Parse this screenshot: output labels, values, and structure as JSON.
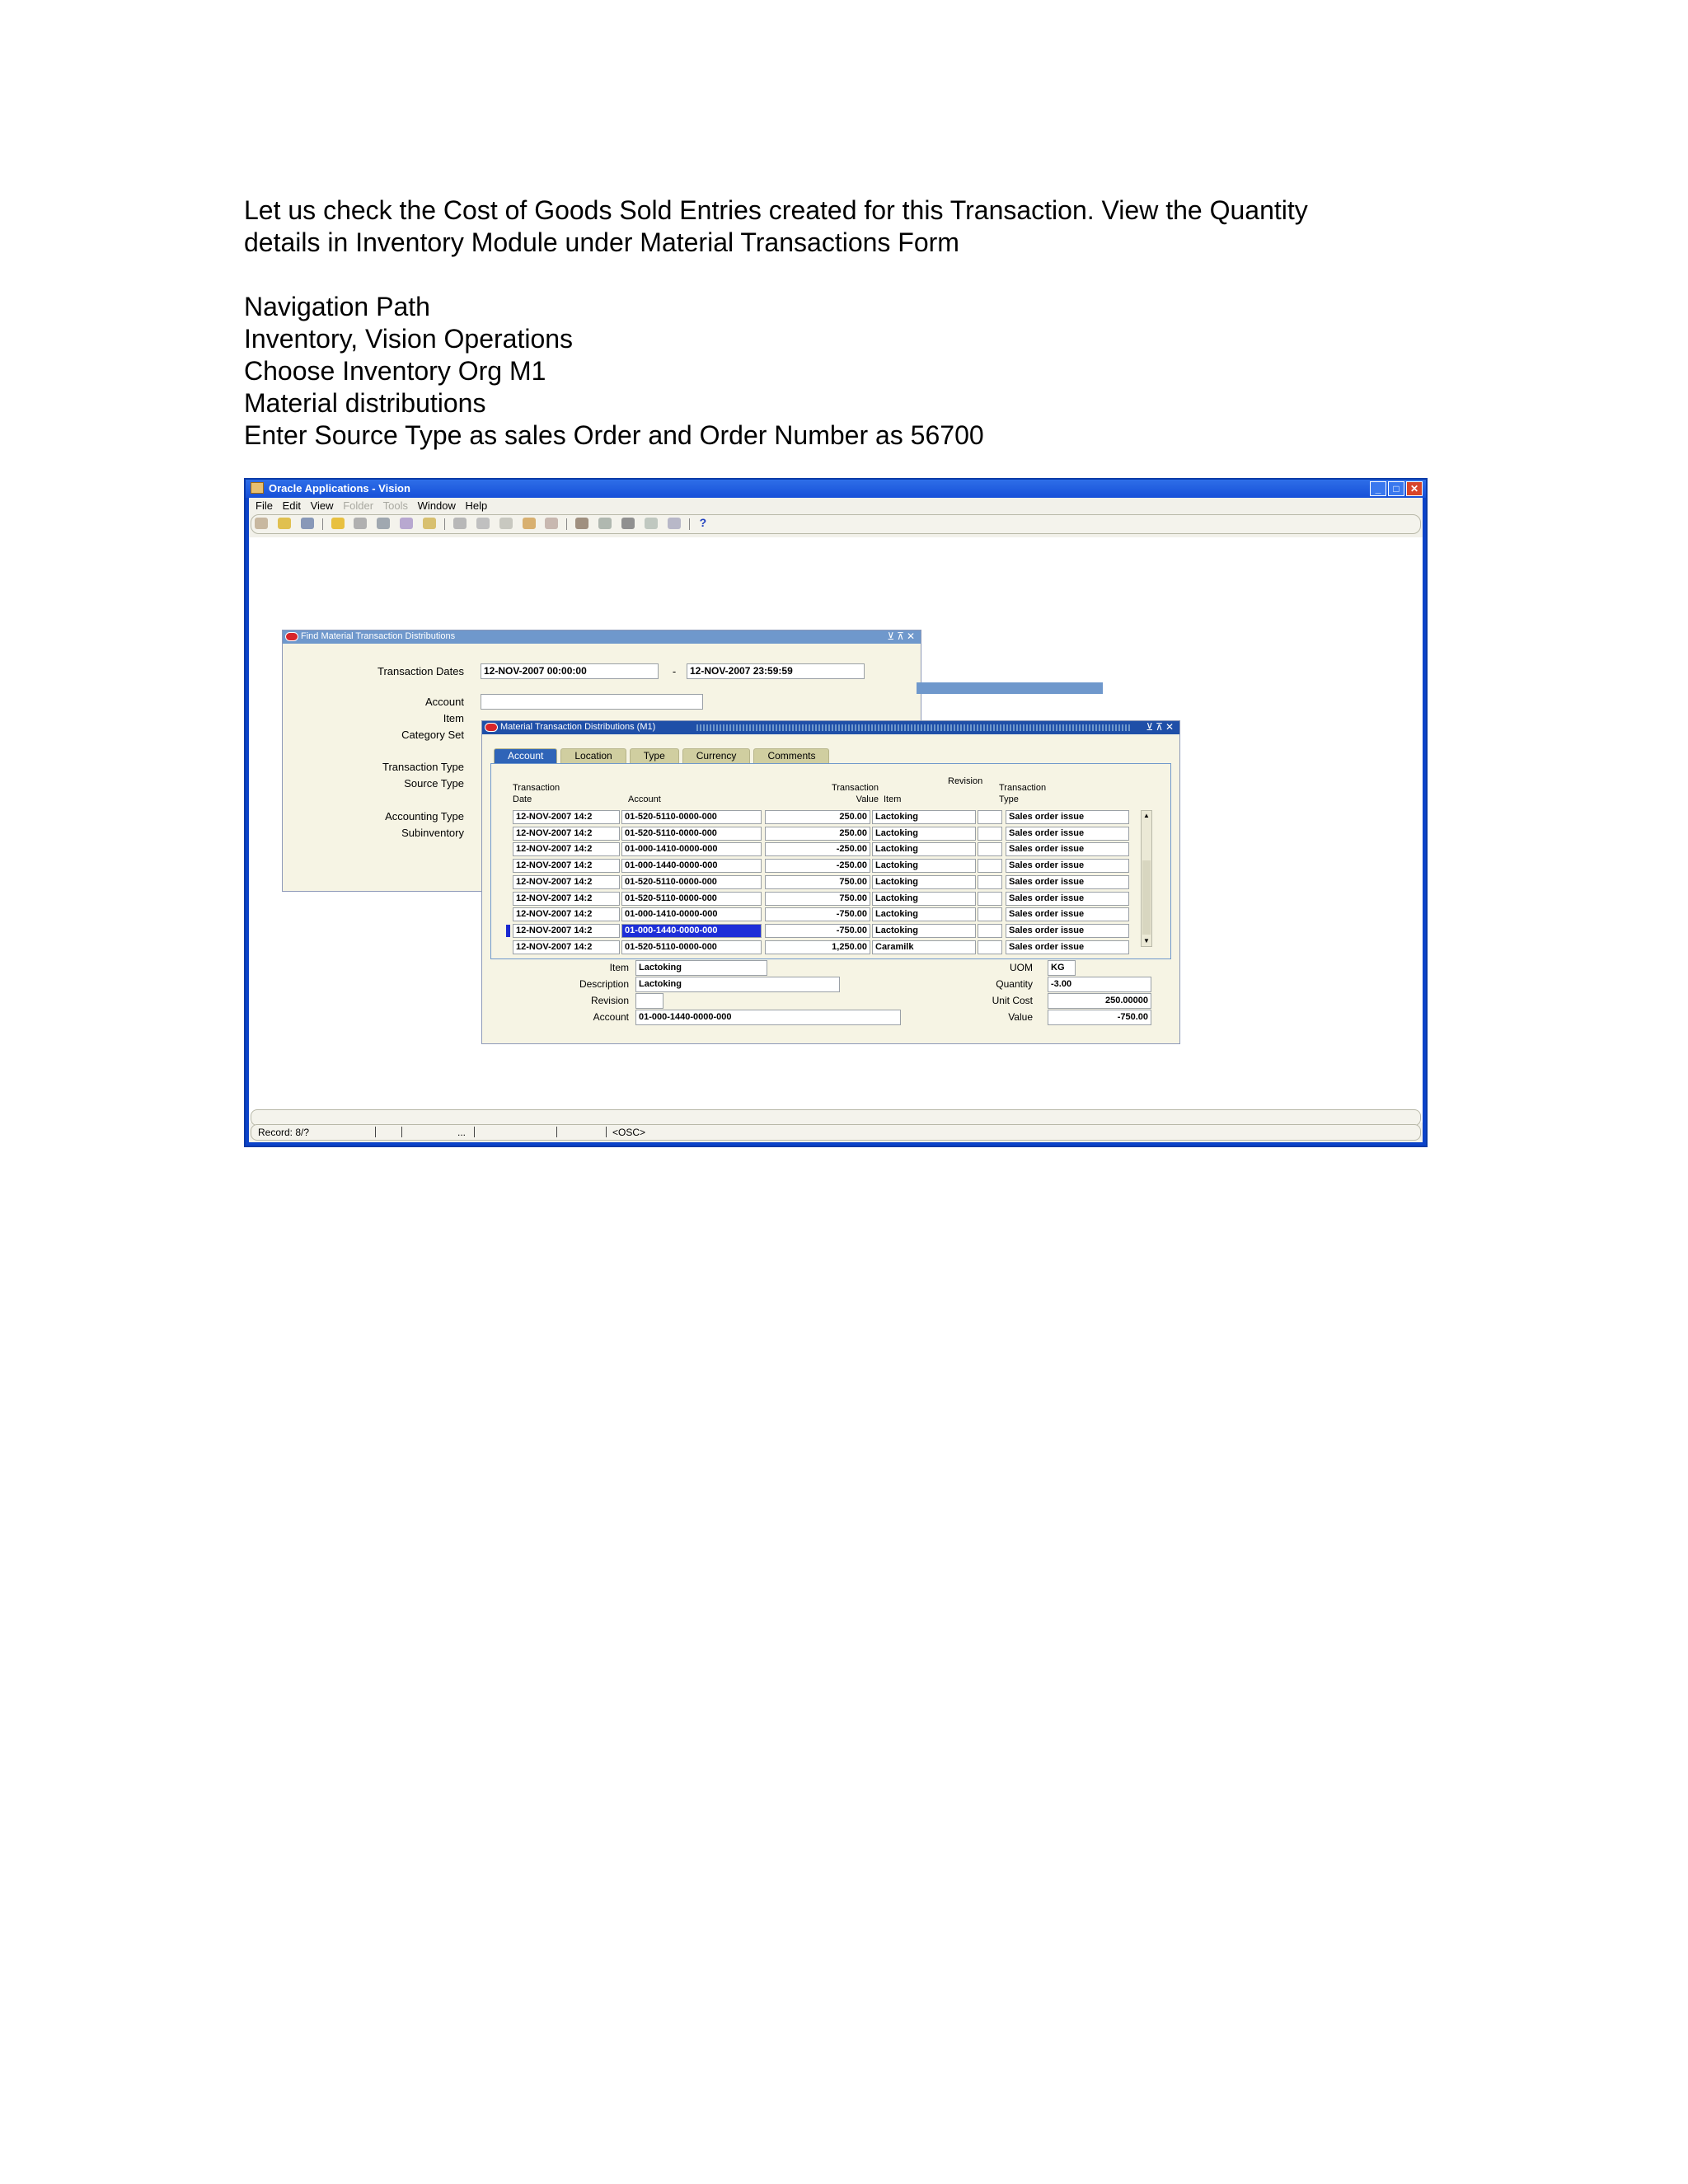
{
  "intro": {
    "lines": [
      "Let us check the Cost of Goods Sold Entries created for this Transaction. View the Quantity",
      "details in Inventory Module under Material Transactions Form",
      "",
      "Navigation Path",
      "Inventory, Vision Operations",
      "Choose Inventory Org M1",
      "Material distributions",
      "Enter Source Type as sales Order and Order Number as 56700"
    ]
  },
  "app": {
    "title": "Oracle Applications - Vision",
    "menu": [
      "File",
      "Edit",
      "View",
      "Folder",
      "Tools",
      "Window",
      "Help"
    ],
    "status": {
      "record": "Record: 8/?",
      "ellipsis": "...",
      "osc": "<OSC>"
    }
  },
  "find": {
    "title": "Find Material Transaction Distributions",
    "labels": {
      "transaction_dates": "Transaction Dates",
      "account": "Account",
      "item": "Item",
      "category_set": "Category Set",
      "transaction_type": "Transaction Type",
      "source_type": "Source Type",
      "accounting_type": "Accounting Type",
      "subinventory": "Subinventory"
    },
    "date_from": "12-NOV-2007 00:00:00",
    "date_to": "12-NOV-2007 23:59:59",
    "date_sep": "-"
  },
  "mtd": {
    "title": "Material Transaction Distributions (M1)",
    "tabs": [
      "Account",
      "Location",
      "Type",
      "Currency",
      "Comments"
    ],
    "headers": {
      "trans_date_1": "Transaction",
      "trans_date_2": "Date",
      "account": "Account",
      "value_1": "Transaction",
      "value_2": "Value",
      "item": "Item",
      "revision": "Revision",
      "type_1": "Transaction",
      "type_2": "Type"
    },
    "rows": [
      {
        "date": "12-NOV-2007 14:2",
        "account": "01-520-5110-0000-000",
        "value": "250.00",
        "item": "Lactoking",
        "rev": "",
        "type": "Sales order issue"
      },
      {
        "date": "12-NOV-2007 14:2",
        "account": "01-520-5110-0000-000",
        "value": "250.00",
        "item": "Lactoking",
        "rev": "",
        "type": "Sales order issue"
      },
      {
        "date": "12-NOV-2007 14:2",
        "account": "01-000-1410-0000-000",
        "value": "-250.00",
        "item": "Lactoking",
        "rev": "",
        "type": "Sales order issue"
      },
      {
        "date": "12-NOV-2007 14:2",
        "account": "01-000-1440-0000-000",
        "value": "-250.00",
        "item": "Lactoking",
        "rev": "",
        "type": "Sales order issue"
      },
      {
        "date": "12-NOV-2007 14:2",
        "account": "01-520-5110-0000-000",
        "value": "750.00",
        "item": "Lactoking",
        "rev": "",
        "type": "Sales order issue"
      },
      {
        "date": "12-NOV-2007 14:2",
        "account": "01-520-5110-0000-000",
        "value": "750.00",
        "item": "Lactoking",
        "rev": "",
        "type": "Sales order issue"
      },
      {
        "date": "12-NOV-2007 14:2",
        "account": "01-000-1410-0000-000",
        "value": "-750.00",
        "item": "Lactoking",
        "rev": "",
        "type": "Sales order issue"
      },
      {
        "date": "12-NOV-2007 14:2",
        "account": "01-000-1440-0000-000",
        "value": "-750.00",
        "item": "Lactoking",
        "rev": "",
        "type": "Sales order issue"
      },
      {
        "date": "12-NOV-2007 14:2",
        "account": "01-520-5110-0000-000",
        "value": "1,250.00",
        "item": "Caramilk",
        "rev": "",
        "type": "Sales order issue"
      }
    ],
    "selected_row": 7,
    "detail": {
      "labels": {
        "item": "Item",
        "description": "Description",
        "revision": "Revision",
        "account": "Account",
        "uom": "UOM",
        "quantity": "Quantity",
        "unit_cost": "Unit  Cost",
        "value": "Value"
      },
      "item": "Lactoking",
      "description": "Lactoking",
      "revision": "",
      "account": "01-000-1440-0000-000",
      "uom": "KG",
      "quantity": "-3.00",
      "unit_cost": "250.00000",
      "value": "-750.00"
    }
  }
}
